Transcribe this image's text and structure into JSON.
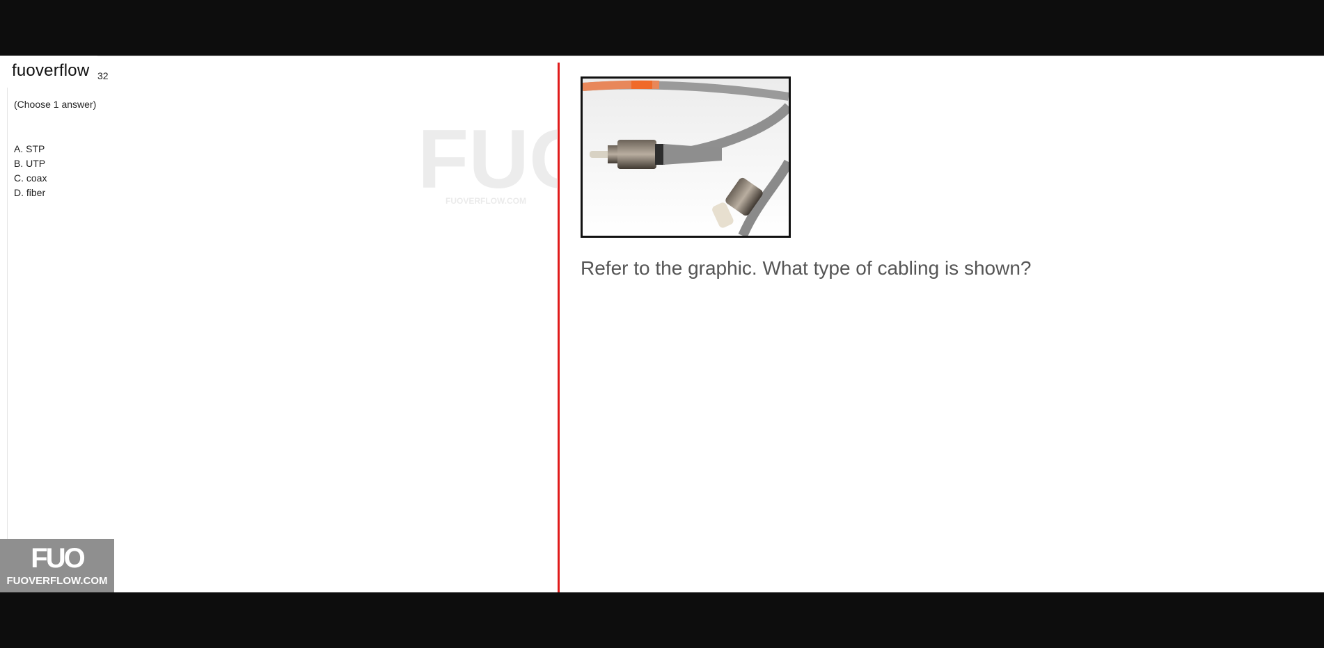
{
  "brand": {
    "name": "fuoverflow"
  },
  "question": {
    "number_fragment": "32",
    "instruction": "(Choose 1 answer)",
    "text": "Refer to the graphic. What type of cabling is shown?",
    "options": [
      {
        "label": "A. STP"
      },
      {
        "label": "B. UTP"
      },
      {
        "label": "C. coax"
      },
      {
        "label": "D. fiber"
      }
    ]
  },
  "watermark": {
    "logo": "FUO",
    "url": "FUOVERFLOW.COM"
  },
  "badge": {
    "logo": "FUO",
    "url": "FUOVERFLOW.COM"
  },
  "figure": {
    "icon": "fiber-optic-connector-photo"
  },
  "colors": {
    "divider": "#e01b1b",
    "badge_bg": "#8f8f8f",
    "letterbox": "#0d0d0d"
  }
}
